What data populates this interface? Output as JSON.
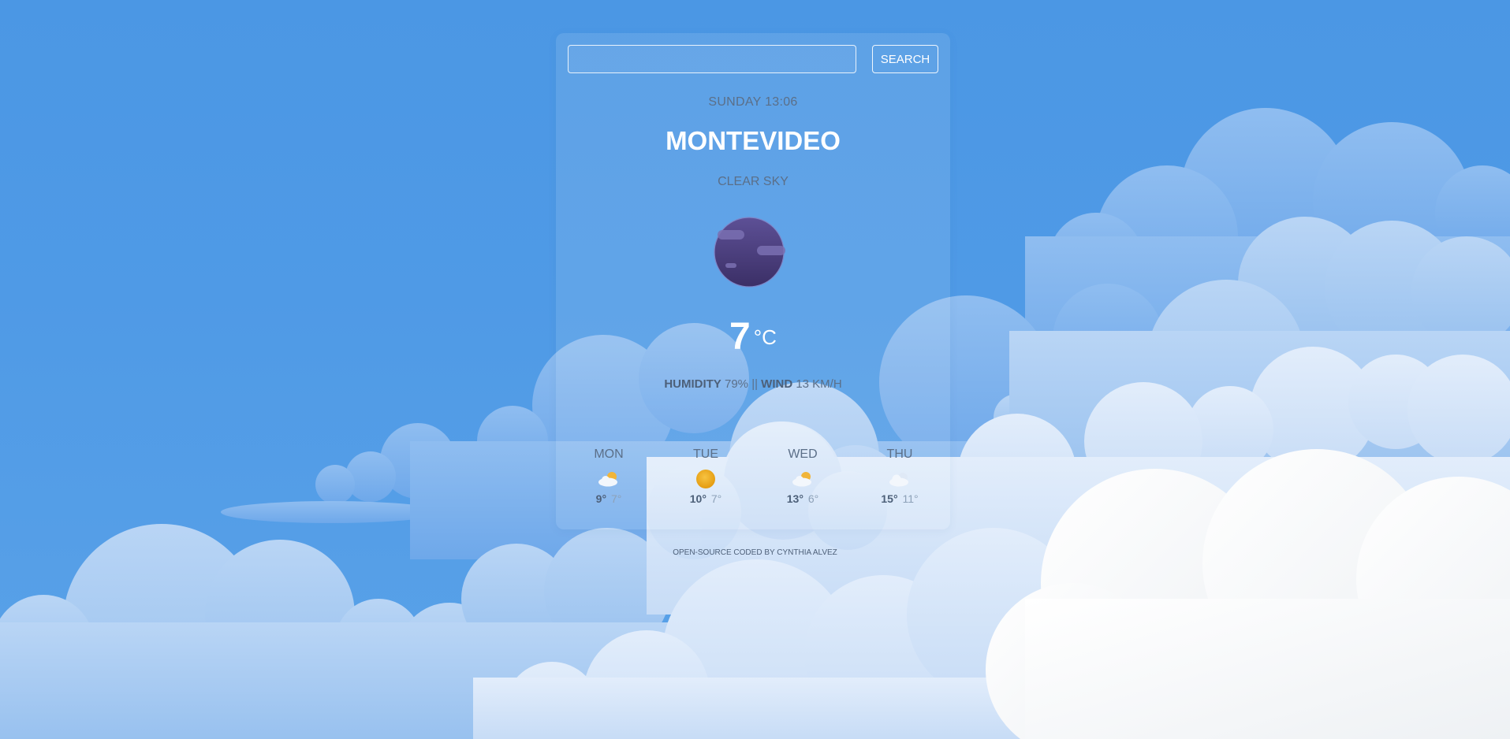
{
  "search": {
    "value": "",
    "placeholder": "",
    "button_label": "SEARCH"
  },
  "current": {
    "datetime": "SUNDAY 13:06",
    "city": "MONTEVIDEO",
    "condition": "CLEAR SKY",
    "icon": "night-clear-moon-icon",
    "temperature": "7",
    "unit": "°C",
    "humidity_label": "HUMIDITY",
    "humidity_value": "79%",
    "separator": "||",
    "wind_label": "WIND",
    "wind_value": "13 KM/H"
  },
  "forecast": [
    {
      "day": "MON",
      "icon": "partly-cloudy-icon",
      "high": "9°",
      "low": "7°"
    },
    {
      "day": "TUE",
      "icon": "sun-icon",
      "high": "10°",
      "low": "7°"
    },
    {
      "day": "WED",
      "icon": "partly-cloudy-icon",
      "high": "13°",
      "low": "6°"
    },
    {
      "day": "THU",
      "icon": "cloudy-icon",
      "high": "15°",
      "low": "11°"
    }
  ],
  "footer": {
    "text": "OPEN-SOURCE CODED BY CYNTHIA ALVEZ"
  },
  "colors": {
    "sky": "#4b97e4",
    "text_muted": "#5b6f88",
    "sun": "#f0a81a",
    "moon_icon": "#4f3f80"
  }
}
